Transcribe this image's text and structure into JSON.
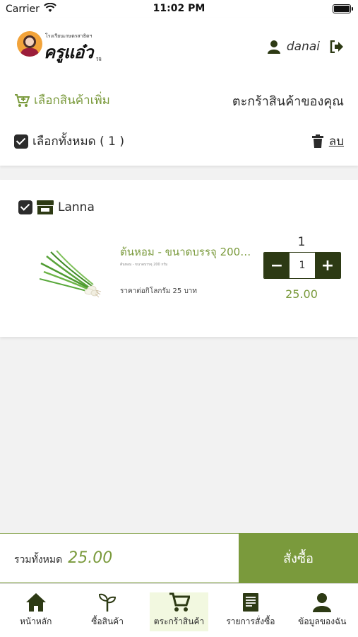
{
  "status_bar": {
    "carrier": "Carrier",
    "time": "11:02 PM"
  },
  "header": {
    "logo": {
      "tagline": "โรงเรียนเกษตรสาธิตฯ",
      "brand": "ครูแอ๋ว",
      "sub": "วีฟี"
    },
    "user": {
      "name": "danai"
    },
    "more_link": "เลือกสินค้าเพิ่ม",
    "cart_title": "ตะกร้าสินค้าของคุณ",
    "select_all": "เลือกทั้งหมด ( 1 )",
    "delete_label": "ลบ"
  },
  "cart": {
    "shop_name": "Lanna",
    "item": {
      "name": "ต้นหอม - ขนาดบรรจุ 200 กรัม",
      "description": "ต้นหอม - ขนาดบรรจุ 200 กรัม",
      "unit_price": "ราคาต่อกิโลกรัม 25 บาท",
      "quantity_label": "1",
      "quantity_value": "1",
      "line_total": "25.00"
    }
  },
  "footer": {
    "total_label": "รวมทั้งหมด",
    "total_amount": "25.00",
    "order_button": "สั่งซื้อ"
  },
  "tabs": [
    {
      "label": "หน้าหลัก",
      "icon": "home-icon"
    },
    {
      "label": "ซื้อสินค้า",
      "icon": "sprout-icon"
    },
    {
      "label": "ตระกร้าสินค้า",
      "icon": "cart-icon",
      "active": true
    },
    {
      "label": "รายการสั่งซื้อ",
      "icon": "receipt-icon"
    },
    {
      "label": "ข้อมูลของฉัน",
      "icon": "user-icon"
    }
  ],
  "colors": {
    "accent": "#7a9a3c",
    "dark": "#2d3a14",
    "active_tab_bg": "#f2f8e0"
  }
}
